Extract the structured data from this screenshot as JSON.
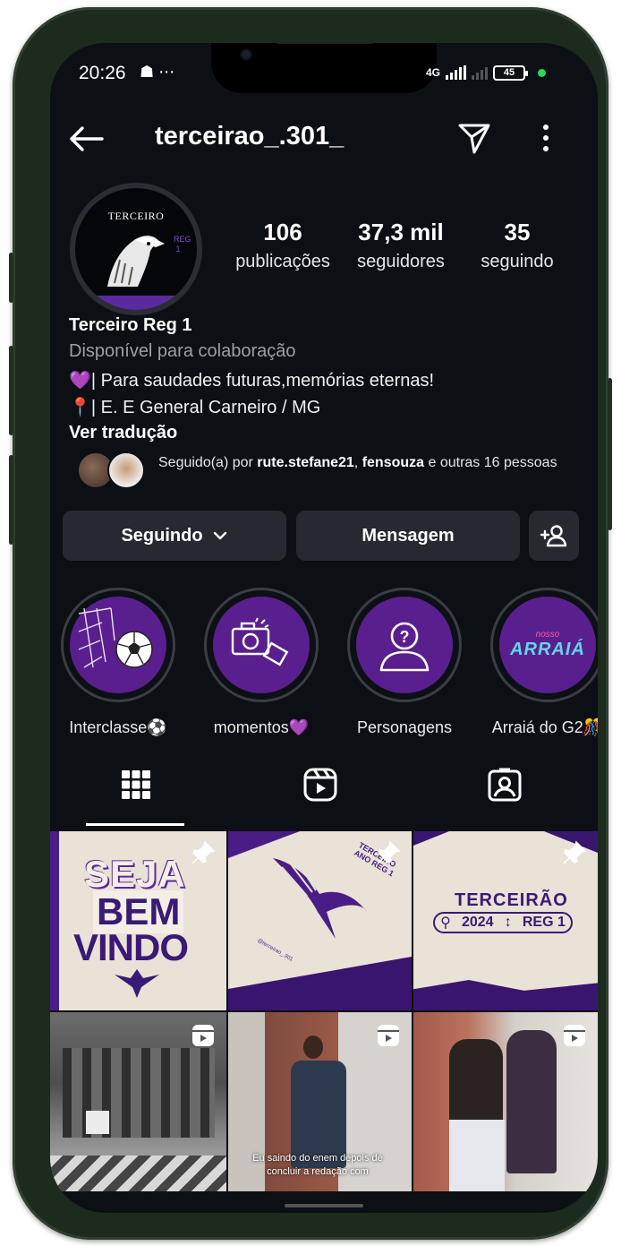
{
  "status_bar": {
    "time": "20:26",
    "left_icons": "☗ ⋯",
    "network": "4G",
    "battery": "45"
  },
  "header": {
    "username": "terceirao_.301_"
  },
  "profile": {
    "avatar_text": "TERCEIRO",
    "avatar_side_text": "REG 1",
    "stats": [
      {
        "value": "106",
        "label": "publicações"
      },
      {
        "value": "37,3 mil",
        "label": "seguidores"
      },
      {
        "value": "35",
        "label": "seguindo"
      }
    ],
    "name": "Terceiro Reg 1",
    "category": "Disponível para colaboração",
    "bio_line_1": "💜| Para saudades futuras,memórias eternas!",
    "bio_line_2": "📍| E. E General Carneiro / MG",
    "translate_label": "Ver tradução",
    "followed_by_prefix": "Seguido(a) por ",
    "followed_by_user_1": "rute.stefane21",
    "followed_by_sep": ", ",
    "followed_by_user_2": "fensouza",
    "followed_by_suffix": " e outras 16 pessoas"
  },
  "actions": {
    "following_label": "Seguindo",
    "message_label": "Mensagem"
  },
  "highlights": [
    {
      "label": "Interclasse⚽"
    },
    {
      "label": "momentos💜"
    },
    {
      "label": "Personagens"
    },
    {
      "label": "Arraiá do G2🎊",
      "cover_text": "ARRAIÁ",
      "cover_small": "nosso"
    }
  ],
  "grid": {
    "tile1": {
      "line1": "SEJA",
      "line2": "BEM",
      "line3": "VINDO"
    },
    "tile2": {
      "corner_text": "TERCEIRO ANO REG 1",
      "small_text": "@terceirao_.301"
    },
    "tile3": {
      "title": "TERCEIRÃO",
      "year": "2024",
      "reg": "REG 1"
    },
    "tile5": {
      "caption": "Eu saindo do enem depois de concluir a redação com"
    }
  },
  "colors": {
    "background": "#0c0f14",
    "button": "#26292f",
    "highlight_purple": "#5a1f8e",
    "brand_purple": "#3a1a74"
  }
}
